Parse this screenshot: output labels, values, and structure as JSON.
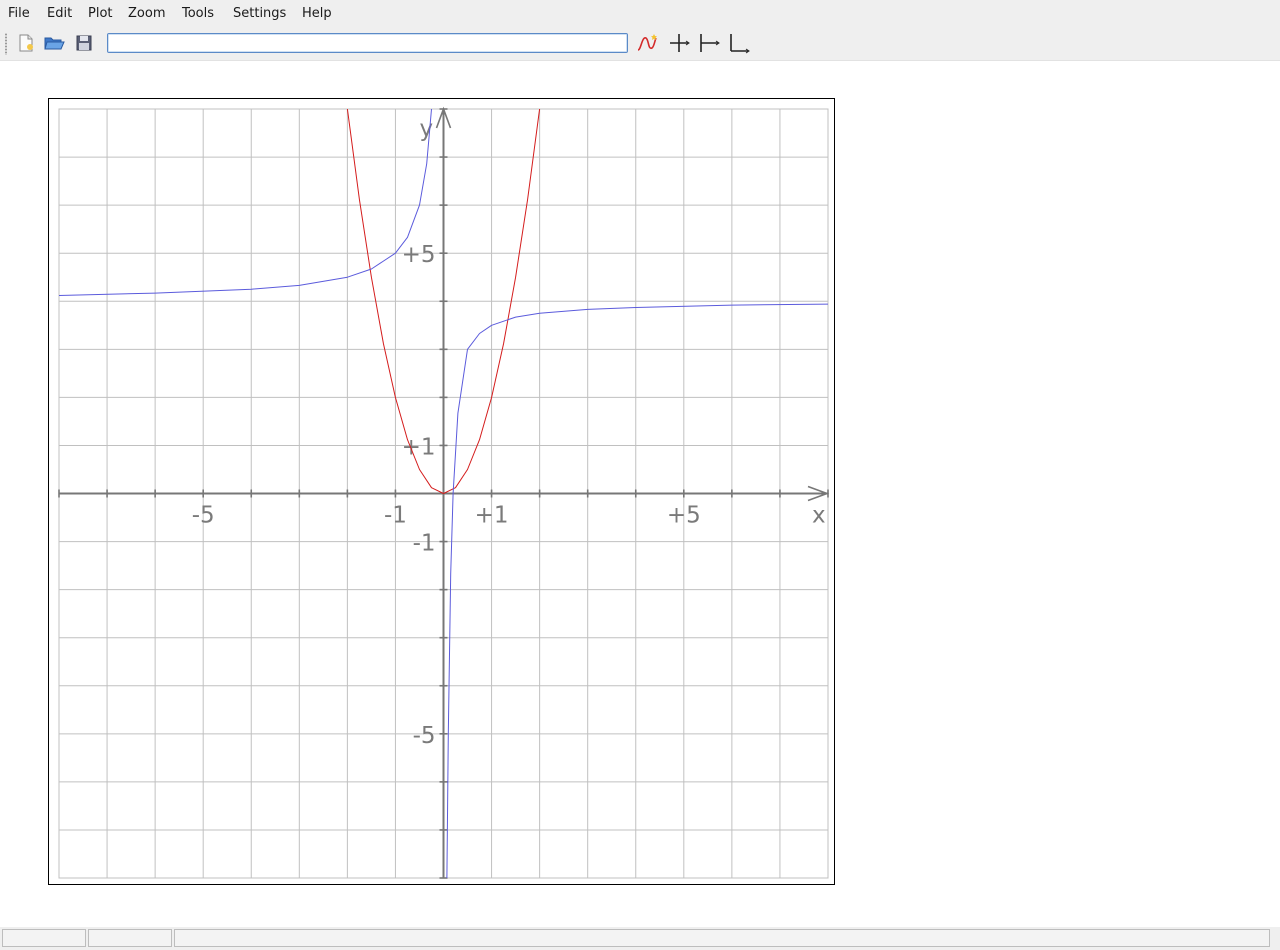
{
  "menu": [
    "File",
    "Edit",
    "Plot",
    "Zoom",
    "Tools",
    "Settings",
    "Help"
  ],
  "toolbar": {
    "buttons": [
      "new-file-icon",
      "open-folder-icon",
      "save-disk-icon"
    ],
    "function_input_value": "",
    "right_buttons": [
      "new-function-icon",
      "axes-cross-icon",
      "axes-left-icon",
      "axes-corner-icon"
    ]
  },
  "chart_data": {
    "type": "line",
    "xlim": [
      -8,
      8
    ],
    "ylim": [
      -8,
      8
    ],
    "grid": true,
    "xlabel": "x",
    "ylabel": "y",
    "x_tick_labels": [
      {
        "value": -5,
        "label": "-5"
      },
      {
        "value": -1,
        "label": "-1"
      },
      {
        "value": 1,
        "label": "+1"
      },
      {
        "value": 5,
        "label": "+5"
      }
    ],
    "y_tick_labels": [
      {
        "value": 5,
        "label": "+5"
      },
      {
        "value": 1,
        "label": "+1"
      },
      {
        "value": -1,
        "label": "-1"
      },
      {
        "value": -5,
        "label": "-5"
      }
    ],
    "colors": {
      "axis": "#777777",
      "grid": "#c0c0c0",
      "tick_label": "#7a7a7a"
    },
    "series": [
      {
        "color": "#d41c1c",
        "x": [
          -2,
          -1.75,
          -1.5,
          -1.25,
          -1,
          -0.75,
          -0.5,
          -0.25,
          0,
          0.25,
          0.5,
          0.75,
          1,
          1.25,
          1.5,
          1.75,
          2
        ],
        "y": [
          8.0,
          6.12,
          4.5,
          3.12,
          2.0,
          1.12,
          0.5,
          0.12,
          0.0,
          0.12,
          0.5,
          1.12,
          2.0,
          3.12,
          4.5,
          6.12,
          8.0
        ]
      },
      {
        "color": "#5b5bdc",
        "x": [
          -8,
          -6,
          -4,
          -3,
          -2,
          -1.5,
          -1,
          -0.75,
          -0.5,
          -0.35,
          -0.25
        ],
        "y": [
          4.12,
          4.17,
          4.25,
          4.33,
          4.5,
          4.67,
          5.0,
          5.33,
          6.0,
          6.86,
          8.0
        ]
      },
      {
        "color": "#5b5bdc",
        "x": [
          0.07,
          0.1,
          0.15,
          0.2,
          0.3,
          0.5,
          0.75,
          1,
          1.5,
          2,
          3,
          4,
          6,
          8
        ],
        "y": [
          -8.0,
          -5.0,
          -1.67,
          0.0,
          1.67,
          3.0,
          3.33,
          3.5,
          3.67,
          3.75,
          3.83,
          3.87,
          3.92,
          3.94
        ]
      }
    ]
  },
  "status": [
    "",
    "",
    ""
  ]
}
